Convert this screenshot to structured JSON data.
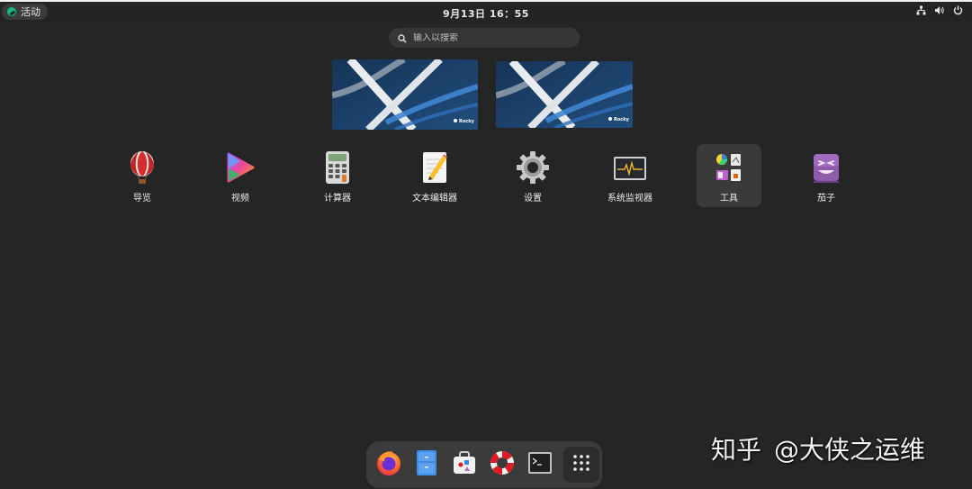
{
  "topbar": {
    "activities_label": "活动",
    "clock": "9月13日 16：55",
    "icons": [
      "network-icon",
      "volume-icon",
      "power-icon"
    ]
  },
  "search": {
    "placeholder": "输入以搜索"
  },
  "workspaces": [
    {
      "brand": "Rocky"
    },
    {
      "brand": "Rocky"
    }
  ],
  "apps": [
    {
      "label": "导览",
      "icon": "tour-balloon-icon"
    },
    {
      "label": "视频",
      "icon": "video-player-icon"
    },
    {
      "label": "计算器",
      "icon": "calculator-icon"
    },
    {
      "label": "文本编辑器",
      "icon": "text-editor-icon"
    },
    {
      "label": "设置",
      "icon": "settings-gear-icon"
    },
    {
      "label": "系统监视器",
      "icon": "system-monitor-icon"
    },
    {
      "label": "工具",
      "icon": "utilities-folder-icon",
      "selected": true
    },
    {
      "label": "茄子",
      "icon": "cheese-camera-icon"
    }
  ],
  "dock": {
    "items": [
      {
        "icon": "firefox-icon"
      },
      {
        "icon": "files-icon"
      },
      {
        "icon": "software-store-icon"
      },
      {
        "icon": "help-lifebuoy-icon"
      },
      {
        "icon": "terminal-icon"
      },
      {
        "icon": "show-apps-grid-icon"
      }
    ]
  },
  "watermark": {
    "site": "知乎",
    "author": "@大侠之运维"
  },
  "colors": {
    "background": "#252525",
    "topbar": "#242424",
    "accent_green": "#10b981",
    "selected_tile": "#3a3a3a",
    "dock": "#3b3b3b"
  }
}
